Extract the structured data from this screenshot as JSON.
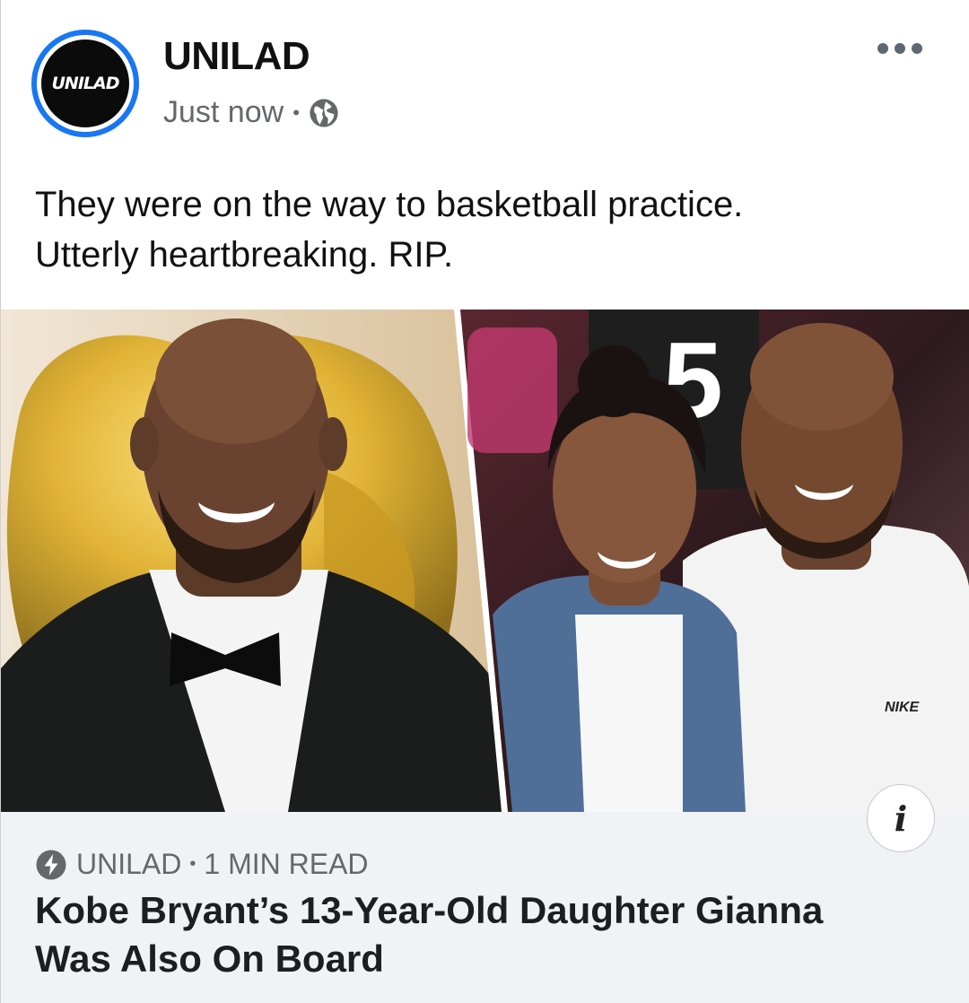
{
  "post": {
    "page_name": "UNILAD",
    "avatar_logo": "UNILAD",
    "timestamp": "Just now",
    "separator": "•",
    "privacy_icon": "globe-icon",
    "more_icon": "more-horizontal-icon",
    "caption_line1": "They were on the way to basketball practice.",
    "caption_line2": "Utterly heartbreaking. RIP."
  },
  "media": {
    "info_icon": "info-icon",
    "info_glyph": "i",
    "number_on_board": "5",
    "shirt_logo": "NIKE"
  },
  "link_preview": {
    "source_icon": "lightning-icon",
    "source": "UNILAD",
    "separator": "•",
    "read_time": "1 MIN READ",
    "headline_line1": "Kobe Bryant’s 13-Year-Old Daughter Gianna",
    "headline_line2": "Was Also On Board"
  },
  "colors": {
    "brand_blue": "#1877f2",
    "meta_gray": "#65676b",
    "link_bg": "#f0f2f5"
  }
}
